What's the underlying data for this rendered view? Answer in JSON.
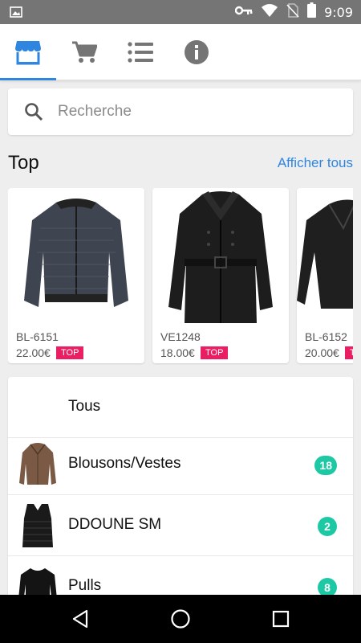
{
  "status_bar": {
    "time": "9:09",
    "icons": [
      "image-icon",
      "key-icon",
      "wifi-icon",
      "no-sim-icon",
      "battery-icon"
    ]
  },
  "tabs": [
    {
      "name": "store-icon",
      "active": true
    },
    {
      "name": "cart-icon",
      "active": false
    },
    {
      "name": "list-icon",
      "active": false
    },
    {
      "name": "info-icon",
      "active": false
    }
  ],
  "search": {
    "placeholder": "Recherche"
  },
  "top_section": {
    "title": "Top",
    "link": "Afficher tous"
  },
  "products": [
    {
      "code": "BL-6151",
      "price": "22.00€",
      "badge": "TOP",
      "image": "quilted-bomber-jacket"
    },
    {
      "code": "VE1248",
      "price": "18.00€",
      "badge": "TOP",
      "image": "black-trench-coat"
    },
    {
      "code": "BL-6152",
      "price": "20.00€",
      "badge": "TOP",
      "image": "black-leather-jacket"
    }
  ],
  "categories": [
    {
      "label": "Tous",
      "count": null,
      "image": null
    },
    {
      "label": "Blousons/Vestes",
      "count": "18",
      "image": "brown-leather-jacket"
    },
    {
      "label": "DDOUNE SM",
      "count": "2",
      "image": "black-quilted-vest"
    },
    {
      "label": "Pulls",
      "count": "8",
      "image": "black-sweater"
    }
  ],
  "colors": {
    "accent": "#2f86e0",
    "badge": "#e91e63",
    "count": "#1dc9a4",
    "status_bar": "#757575"
  },
  "nav": [
    "back-icon",
    "home-icon",
    "recents-icon"
  ]
}
